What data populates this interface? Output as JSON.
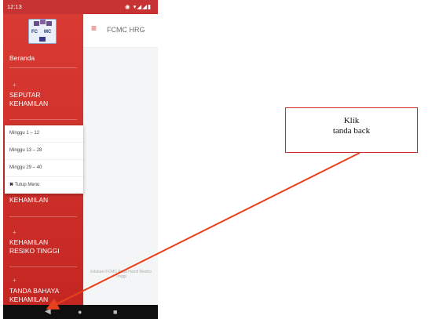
{
  "status_bar": {
    "time": "12:13",
    "icons": "◉ ▾◢◢▮"
  },
  "app": {
    "title": "FCMC HRG",
    "menu_icon": "hamburger-icon"
  },
  "logo": {
    "line1": "FC",
    "line2": "MC"
  },
  "sidebar": {
    "items": [
      {
        "label": "Beranda"
      },
      {
        "label": "SEPUTAR\nKEHAMILAN",
        "icon": "+"
      },
      {
        "label": "SEPUTAR\nKEHAMILAN",
        "icon": "+"
      },
      {
        "label": "KEHAMILAN\nRESIKO TINGGI",
        "icon": "+"
      },
      {
        "label": "TANDA BAHAYA\nKEHAMILAN",
        "icon": "+"
      }
    ]
  },
  "popup": {
    "items": [
      {
        "label": "Minggu 1 – 12"
      },
      {
        "label": "Minggu 13 – 28"
      },
      {
        "label": "Minggu 29 – 40"
      }
    ],
    "close_label": "Tutup Menu"
  },
  "footer_faded": "Edukasi FCMC Pada Hamil Resiko Tinggi",
  "annotation": {
    "line1": "Klik",
    "line2": "tanda back",
    "color": "#e8401c"
  },
  "colors": {
    "sidebar": "#d0302b",
    "status_bar": "#c73333"
  }
}
